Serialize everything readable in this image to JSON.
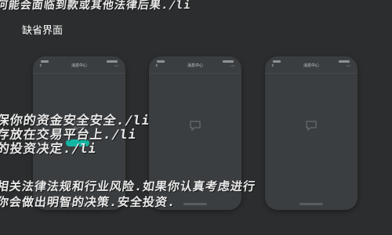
{
  "background_lines": [
    "何能会面临到款或其他法律后果./li",
    "保你的资金安全安全./li",
    "存放在交易平台上./li",
    "的投资决定./li",
    "相关法律法规和行业风险.如果你认真考虑进行",
    "你会做出明智的决策.安全投资."
  ],
  "default_screen_label": "缺省界面",
  "phones": [
    {
      "title": "消息中心",
      "back_icon": "‹",
      "menu_icon": "⋯"
    },
    {
      "title": "消息中心",
      "back_icon": "‹",
      "menu_icon": "⋯"
    },
    {
      "title": "消息中心",
      "back_icon": "‹",
      "menu_icon": "⋯"
    }
  ],
  "colors": {
    "background": "#2b2d2e",
    "phone_body": "#3b3e41",
    "accent_teal": "#14b5a3"
  }
}
